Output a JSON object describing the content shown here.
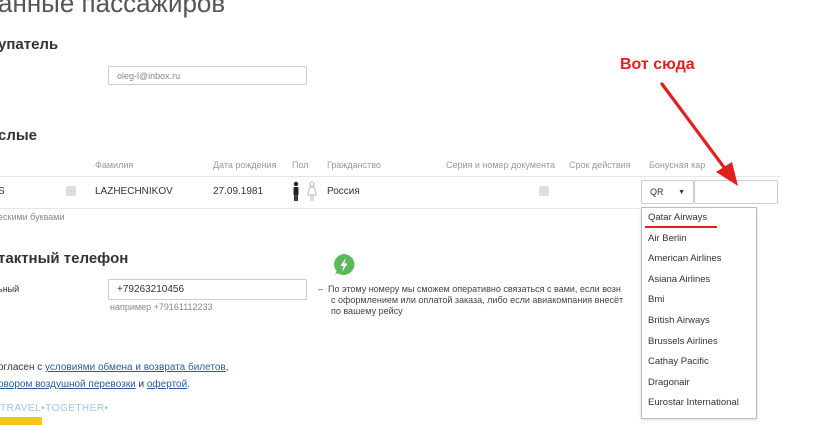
{
  "page": {
    "title": "анные пассажиров"
  },
  "buyer": {
    "section_title": "упатель",
    "email_value": "oleg-l@inbox.ru"
  },
  "adults": {
    "section_title": "слые",
    "columns": {
      "surname": "Фамилия",
      "birthdate": "Дата рождения",
      "sex": "Пол",
      "citizenship": "Гражданство",
      "doc_number": "Серия и номер документа",
      "validity": "Срок действия",
      "bonus_card": "Бонусная кар"
    },
    "row": {
      "first_name_fragment": "S",
      "surname": "LAZHECHNIKOV",
      "birthdate": "27.09.1981",
      "citizenship": "Россия",
      "bonus_airline_code": "QR"
    },
    "hint": "ескими буквами"
  },
  "phone": {
    "section_title": "тактный телефон",
    "label": "ьный",
    "value": "+79263210456",
    "example": "например +79161112233",
    "info_line1": "По этому номеру мы сможем оперативно связаться с вами, если возн",
    "info_line2": "с оформлением или оплатой заказа, либо если авиакомпания внесёт",
    "info_line3": "по вашему рейсу"
  },
  "agreement": {
    "line1_prefix": "огласен с ",
    "line1_link": "условиями обмена и возврата билетов",
    "line1_suffix": ",",
    "line2_link1": "овором воздушной перевозки",
    "line2_middle": " и ",
    "line2_link2": "офертой",
    "line2_suffix": "."
  },
  "watermark": "•TRAVEL•TOGETHER•",
  "annotation": {
    "label": "Вот сюда"
  },
  "airline_dropdown": {
    "options": [
      "Qatar Airways",
      "Air Berlin",
      "American Airlines",
      "Asiana Airlines",
      "Bmi",
      "British Airways",
      "Brussels Airlines",
      "Cathay Pacific",
      "Dragonair",
      "Eurostar International"
    ]
  },
  "colors": {
    "accent_red": "#e02020",
    "link_blue": "#2a5b9c",
    "info_green": "#5cb85c",
    "watermark_blue": "#9ec6e6",
    "yellow_button": "#f3c814"
  }
}
